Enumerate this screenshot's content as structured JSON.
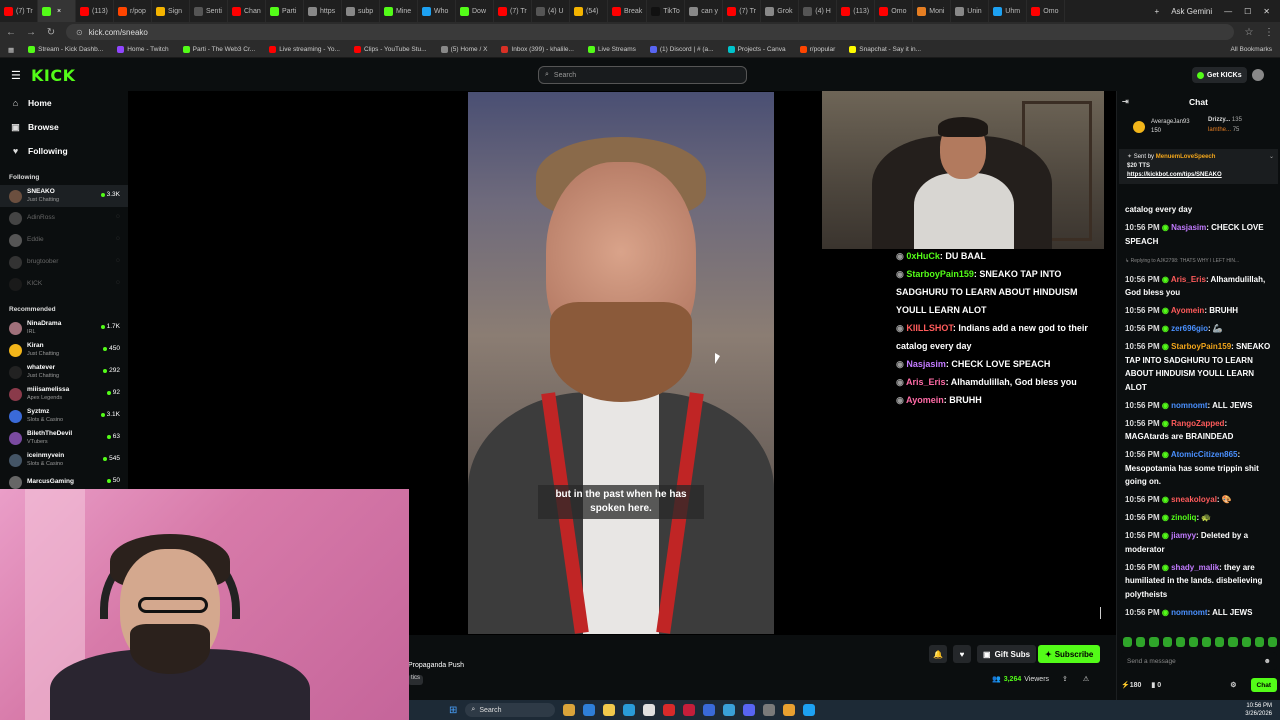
{
  "browser": {
    "tabs": [
      {
        "label": "(7) Tr",
        "color": "#ff0000"
      },
      {
        "label": "",
        "color": "#53fc18",
        "active": true
      },
      {
        "label": "(113)",
        "color": "#ff0000"
      },
      {
        "label": "r/pop",
        "color": "#ff4500"
      },
      {
        "label": "Sign",
        "color": "#f4b400"
      },
      {
        "label": "Senti",
        "color": "#555555"
      },
      {
        "label": "Chan",
        "color": "#ff0000"
      },
      {
        "label": "Parti",
        "color": "#53fc18"
      },
      {
        "label": "https",
        "color": "#888888"
      },
      {
        "label": "subp",
        "color": "#888888"
      },
      {
        "label": "Mine",
        "color": "#53fc18"
      },
      {
        "label": "Who",
        "color": "#1da1f2"
      },
      {
        "label": "Dow",
        "color": "#53fc18"
      },
      {
        "label": "(7) Tr",
        "color": "#ff0000"
      },
      {
        "label": "(4) U",
        "color": "#555555"
      },
      {
        "label": "(54)",
        "color": "#f4b400"
      },
      {
        "label": "Break",
        "color": "#ff0000"
      },
      {
        "label": "TikTo",
        "color": "#111111"
      },
      {
        "label": "can y",
        "color": "#888888"
      },
      {
        "label": "(7) Tr",
        "color": "#ff0000"
      },
      {
        "label": "Grok",
        "color": "#888888"
      },
      {
        "label": "(4) H",
        "color": "#555555"
      },
      {
        "label": "(113)",
        "color": "#ff0000"
      },
      {
        "label": "Omo",
        "color": "#ff0000"
      },
      {
        "label": "Moni",
        "color": "#e67e22"
      },
      {
        "label": "Unin",
        "color": "#888888"
      },
      {
        "label": "Uhm",
        "color": "#1da1f2"
      },
      {
        "label": "Omo",
        "color": "#ff0000"
      }
    ],
    "new_tab": "+",
    "ask_gemini": "Ask Gemini",
    "url": "kick.com/sneako",
    "bookmarks": [
      {
        "label": "Stream - Kick Dashb...",
        "color": "#53fc18"
      },
      {
        "label": "Home - Twitch",
        "color": "#9146ff"
      },
      {
        "label": "Parti - The Web3 Cr...",
        "color": "#53fc18"
      },
      {
        "label": "Live streaming - Yo...",
        "color": "#ff0000"
      },
      {
        "label": "Clips - YouTube Stu...",
        "color": "#ff0000"
      },
      {
        "label": "(5) Home / X",
        "color": "#888888"
      },
      {
        "label": "Inbox (399) - khalile...",
        "color": "#d93025"
      },
      {
        "label": "Live Streams",
        "color": "#53fc18"
      },
      {
        "label": "(1) Discord | # (a...",
        "color": "#5865f2"
      },
      {
        "label": "Projects - Canva",
        "color": "#00c4cc"
      },
      {
        "label": "r/popular",
        "color": "#ff4500"
      },
      {
        "label": "Snapchat - Say it in...",
        "color": "#fffc00"
      }
    ],
    "all_bookmarks": "All Bookmarks"
  },
  "header": {
    "logo": "KICK",
    "search_placeholder": "Search",
    "get_kicks": "Get KICKs"
  },
  "sidebar": {
    "nav": [
      {
        "label": "Home",
        "icon": "⌂"
      },
      {
        "label": "Browse",
        "icon": "▣"
      },
      {
        "label": "Following",
        "icon": "♥"
      }
    ],
    "following_title": "Following",
    "following": [
      {
        "name": "SNEAKO",
        "category": "Just Chatting",
        "viewers": "3.3K",
        "live": true,
        "color": "#6b4f3f"
      },
      {
        "name": "AdinRoss",
        "category": "",
        "viewers": "",
        "live": false,
        "color": "#444444"
      },
      {
        "name": "Eddie",
        "category": "",
        "viewers": "",
        "live": false,
        "color": "#555555"
      },
      {
        "name": "brugtoober",
        "category": "",
        "viewers": "",
        "live": false,
        "color": "#333333"
      },
      {
        "name": "KICK",
        "category": "",
        "viewers": "",
        "live": false,
        "color": "#1a1a1a"
      }
    ],
    "recommended_title": "Recommended",
    "recommended": [
      {
        "name": "NinaDrama",
        "category": "IRL",
        "viewers": "1.7K",
        "color": "#a0707a"
      },
      {
        "name": "Kiran",
        "category": "Just Chatting",
        "viewers": "450",
        "color": "#f2b51a"
      },
      {
        "name": "whatever",
        "category": "Just Chatting",
        "viewers": "292",
        "color": "#222222"
      },
      {
        "name": "miiisamelissa",
        "category": "Apex Legends",
        "viewers": "92",
        "color": "#8a3a4a"
      },
      {
        "name": "Syztmz",
        "category": "Slots & Casino",
        "viewers": "3.1K",
        "color": "#3a6ad8"
      },
      {
        "name": "BilethTheDevil",
        "category": "VTubers",
        "viewers": "63",
        "color": "#7a4aa0"
      },
      {
        "name": "iceinmyvein",
        "category": "Slots & Casino",
        "viewers": "545",
        "color": "#445566"
      },
      {
        "name": "MarcusGaming",
        "category": "",
        "viewers": "50",
        "color": "#666666"
      }
    ]
  },
  "video": {
    "caption": "but in the past when he has spoken here.",
    "overlay_chat": [
      {
        "user": "0xHuCk",
        "ucolor": "#53fc18",
        "text": ": DU BAAL"
      },
      {
        "user": "StarboyPain159",
        "ucolor": "#53fc18",
        "text": ": SNEAKO TAP INTO SADGHURU TO LEARN ABOUT HINDUISM YOULL LEARN ALOT"
      },
      {
        "user": "KIILLSHOT",
        "ucolor": "#ff5b5b",
        "text": ": Indians add a new god to their catalog every day"
      },
      {
        "user": "Nasjasim",
        "ucolor": "#c27bff",
        "text": ": CHECK LOVE SPEACH"
      },
      {
        "user": "Aris_Eris",
        "ucolor": "#ff6ba6",
        "text": ": Alhamdulillah, God bless you"
      },
      {
        "user": "Ayomein",
        "ucolor": "#ff6ba6",
        "text": ": BRUHH"
      }
    ]
  },
  "info": {
    "title": "Propaganda Push",
    "tag": "tics",
    "gift_subs": "Gift Subs",
    "subscribe": "Subscribe",
    "viewers_count": "3,264",
    "viewers_label": "Viewers"
  },
  "chat": {
    "title": "Chat",
    "pinned": {
      "user1": "AverageJan93",
      "amt1": "150",
      "user2": "Drizzy...",
      "amt2": "135",
      "user3": "lamthe...",
      "amt3": "75"
    },
    "sent_by_label": "Sent by",
    "sent_by_user": "MenuemLoveSpeech",
    "tts": "$20 TTS",
    "tts_link": "https://kickbot.com/tips/SNEAKO",
    "messages": [
      {
        "time": "",
        "user": "",
        "ucolor": "#ffffff",
        "text": "catalog every day"
      },
      {
        "time": "10:56 PM",
        "user": "Nasjasim",
        "ucolor": "#c27bff",
        "text": ": CHECK LOVE SPEACH"
      },
      {
        "time": "",
        "user": "",
        "ucolor": "#888888",
        "text": "",
        "reply": "Replying to AJK2798: THATS WHY I LEFT HIN..."
      },
      {
        "time": "10:56 PM",
        "user": "Aris_Eris",
        "ucolor": "#ff5b5b",
        "text": ": Alhamdulillah, God bless you"
      },
      {
        "time": "10:56 PM",
        "user": "Ayomein",
        "ucolor": "#ff5b5b",
        "text": ": BRUHH"
      },
      {
        "time": "10:56 PM",
        "user": "zer696gio",
        "ucolor": "#4a90ff",
        "text": ": 🦾"
      },
      {
        "time": "10:56 PM",
        "user": "StarboyPain159",
        "ucolor": "#f2a51a",
        "text": ": SNEAKO TAP INTO SADGHURU TO LEARN ABOUT HINDUISM YOULL LEARN ALOT"
      },
      {
        "time": "10:56 PM",
        "user": "nomnomt",
        "ucolor": "#4a90ff",
        "text": ": ALL JEWS"
      },
      {
        "time": "10:56 PM",
        "user": "RangoZapped",
        "ucolor": "#ff5b5b",
        "text": ": MAGAtards are BRAINDEAD"
      },
      {
        "time": "10:56 PM",
        "user": "AtomicCitizen865",
        "ucolor": "#4a90ff",
        "text": ": Mesopotamia has some trippin shit going on."
      },
      {
        "time": "10:56 PM",
        "user": "sneakoloyal",
        "ucolor": "#ff5b5b",
        "text": ": 🎨"
      },
      {
        "time": "10:56 PM",
        "user": "zinoliq",
        "ucolor": "#53fc18",
        "text": ": 🐢"
      },
      {
        "time": "10:56 PM",
        "user": "jiamyy",
        "ucolor": "#c27bff",
        "text": ": Deleted by a moderator"
      },
      {
        "time": "10:56 PM",
        "user": "shady_malik",
        "ucolor": "#c27bff",
        "text": ": they are humiliated in the lands. disbelieving polytheists"
      },
      {
        "time": "10:56 PM",
        "user": "nomnomt",
        "ucolor": "#4a90ff",
        "text": ": ALL JEWS"
      }
    ],
    "input_placeholder": "Send a message",
    "kicks_balance": "180",
    "count2": "0",
    "chat_button": "Chat"
  },
  "taskbar": {
    "search": "Search",
    "time": "10:56 PM",
    "date": "3/26/2026"
  }
}
